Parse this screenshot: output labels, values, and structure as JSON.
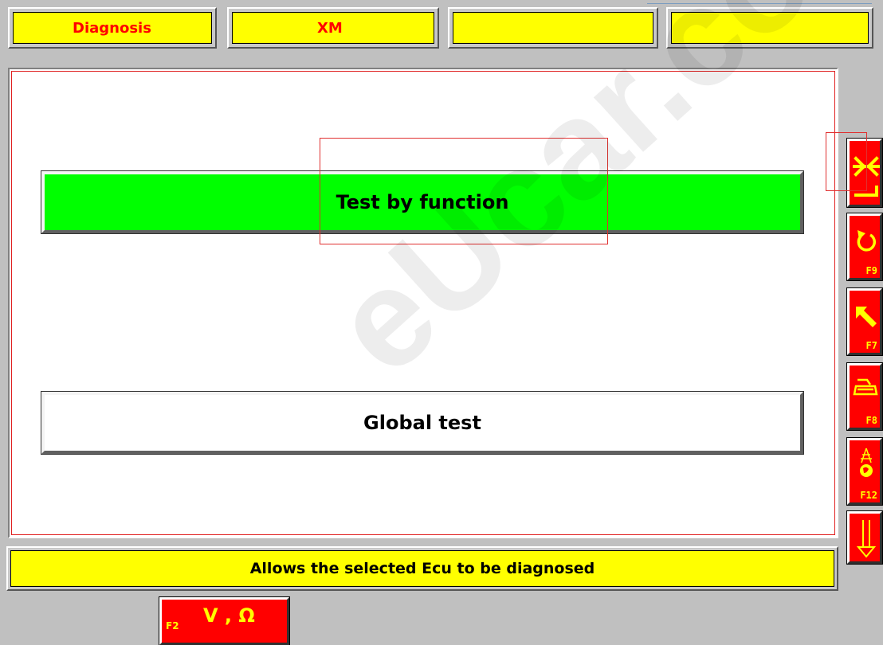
{
  "header": {
    "tabs": [
      {
        "label": "Diagnosis"
      },
      {
        "label": "XM"
      },
      {
        "label": ""
      },
      {
        "label": ""
      }
    ]
  },
  "main": {
    "buttons": [
      {
        "label": "Test by function",
        "selected": true,
        "color": "#00ff00"
      },
      {
        "label": "Global test",
        "selected": false,
        "color": "#ffffff"
      }
    ]
  },
  "status": {
    "text": "Allows the selected Ecu to be diagnosed"
  },
  "side_buttons": [
    {
      "icon": "exit-return-icon",
      "key": ""
    },
    {
      "icon": "refresh-icon",
      "key": "F9"
    },
    {
      "icon": "arrow-up-left-icon",
      "key": "F7"
    },
    {
      "icon": "print-icon",
      "key": "F8"
    },
    {
      "icon": "broadcast-globe-icon",
      "key": "F12"
    },
    {
      "icon": "arrow-down-icon",
      "key": ""
    }
  ],
  "measure": {
    "label": "V , Ω",
    "key": "F2"
  },
  "watermark": "eUcar.co",
  "colors": {
    "accent_red": "#ff0000",
    "accent_yellow": "#ffff00",
    "selected_green": "#00ff00",
    "background": "#c0c0c0"
  }
}
